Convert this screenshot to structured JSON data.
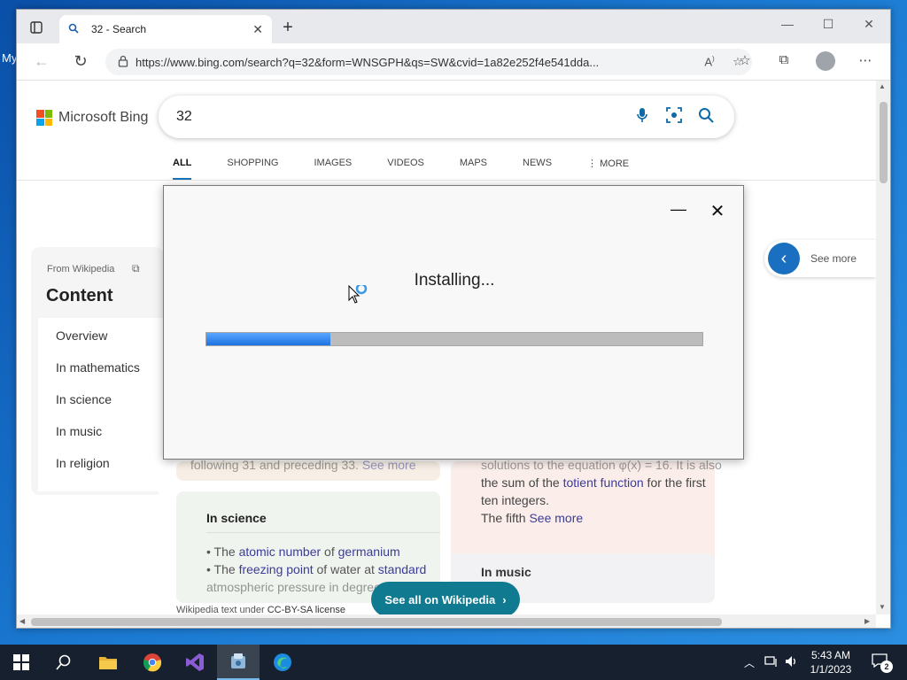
{
  "desktop": {
    "label": "My"
  },
  "browser": {
    "tab": {
      "title": "32 - Search",
      "favicon": "search-icon"
    },
    "address": {
      "url": "https://www.bing.com/search?q=32&form=WNSGPH&qs=SW&cvid=1a82e252f4e541dda..."
    }
  },
  "bing": {
    "logo": "Microsoft Bing",
    "logo_colors": [
      "#f25022",
      "#7fba00",
      "#00a4ef",
      "#ffb900"
    ],
    "query": "32",
    "nav_tabs": [
      "ALL",
      "SHOPPING",
      "IMAGES",
      "VIDEOS",
      "MAPS",
      "NEWS",
      "MORE"
    ],
    "active_tab": "ALL",
    "wiki": {
      "from": "From Wikipedia",
      "heading": "Content",
      "toc": [
        "Overview",
        "In mathematics",
        "In science",
        "In music",
        "In religion"
      ]
    },
    "see_more": "See more",
    "peek_left": {
      "pre": "following 31 and preceding 33.",
      "link": "See more"
    },
    "peek_right": {
      "line1": "solutions to the equation φ(x) = 16. It is also",
      "line2_pre": "the sum of the ",
      "line2_link": "totient function",
      "line2_post": " for the first",
      "line3": "ten integers.",
      "line4_pre": "The fifth ",
      "line4_link": "See more"
    },
    "science": {
      "title": "In science",
      "line1_pre": "• The ",
      "line1_link1": "atomic number",
      "line1_mid": " of ",
      "line1_link2": "germanium",
      "line2_pre": "• The ",
      "line2_link1": "freezing point",
      "line2_mid": " of water at ",
      "line2_link2": "standard",
      "line3": "atmospheric pressure in degrees"
    },
    "music_title": "In music",
    "license_pre": "Wikipedia text under ",
    "license_link": "CC-BY-SA license",
    "see_all": "See all on Wikipedia"
  },
  "installer": {
    "status": "Installing...",
    "progress_percent": 25,
    "progress_color": "#2a7ff0"
  },
  "taskbar": {
    "apps": [
      "windows-start-icon",
      "search-icon",
      "file-explorer-icon",
      "chrome-icon",
      "visual-studio-icon",
      "installer-icon",
      "edge-icon"
    ],
    "active_app": "installer-icon",
    "time": "5:43 AM",
    "date": "1/1/2023",
    "notifications": "2"
  }
}
